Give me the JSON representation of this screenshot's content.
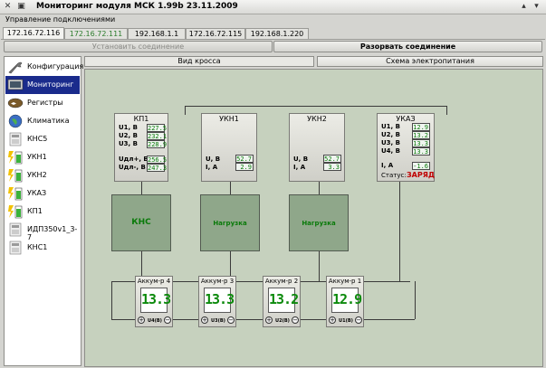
{
  "window": {
    "title": "Мониторинг модуля МСК 1.99b 23.11.2009"
  },
  "menu": {
    "label": "Управление подключениями"
  },
  "ip_tabs": [
    "172.16.72.116",
    "172.16.72.111",
    "192.168.1.1",
    "172.16.72.115",
    "192.168.1.220"
  ],
  "connection": {
    "connect_label": "Установить соединение",
    "disconnect_label": "Разорвать соединение"
  },
  "sidebar": {
    "items": [
      {
        "label": "Конфигурация",
        "icon": "wrench-icon"
      },
      {
        "label": "Мониторинг",
        "icon": "monitor-icon"
      },
      {
        "label": "Регистры",
        "icon": "register-icon"
      },
      {
        "label": "Климатика",
        "icon": "globe-icon"
      },
      {
        "label": "КНС5",
        "icon": "device-icon"
      },
      {
        "label": "УКН1",
        "icon": "battery-icon"
      },
      {
        "label": "УКН2",
        "icon": "battery-icon"
      },
      {
        "label": "УКАЗ",
        "icon": "battery-icon"
      },
      {
        "label": "КП1",
        "icon": "battery-icon"
      },
      {
        "label": "ИДП350v1_3-7",
        "icon": "device-icon"
      },
      {
        "label": "КНС1",
        "icon": "device-icon"
      }
    ]
  },
  "view_tabs": {
    "cross": "Вид кросса",
    "power": "Схема электропитания"
  },
  "devices": {
    "kp1": {
      "title": "КП1",
      "u1_label": "U1, В",
      "u1": "227.5",
      "u2_label": "U2, В",
      "u2": "232.1",
      "u3_label": "U3, В",
      "u3": "228.9",
      "udp_label": "Uдл+, В",
      "udp": "256.5",
      "udm_label": "Uдл-, В",
      "udm": "247.3"
    },
    "ukn1": {
      "title": "УКН1",
      "u_label": "U, В",
      "u": "52.7",
      "i_label": "I, А",
      "i": "2.9"
    },
    "ukn2": {
      "title": "УКН2",
      "u_label": "U, В",
      "u": "52.7",
      "i_label": "I, А",
      "i": "3.3"
    },
    "ukaz": {
      "title": "УКАЗ",
      "u1_label": "U1, В",
      "u1": "12.9",
      "u2_label": "U2, В",
      "u2": "13.2",
      "u3_label": "U3, В",
      "u3": "13.3",
      "u4_label": "U4, В",
      "u4": "13.3",
      "i_label": "I, А",
      "i": "-1.6",
      "status_label": "Статус:",
      "status": "ЗАРЯД"
    }
  },
  "boxes": {
    "kns": "КНС",
    "load1": "Нагрузка",
    "load2": "Нагрузка"
  },
  "batteries": [
    {
      "title": "Аккум-р 4",
      "value": "13.3",
      "label": "U4(В)"
    },
    {
      "title": "Аккум-р 3",
      "value": "13.3",
      "label": "U3(В)"
    },
    {
      "title": "Аккум-р 2",
      "value": "13.2",
      "label": "U2(В)"
    },
    {
      "title": "Аккум-р 1",
      "value": "12.9",
      "label": "U1(В)"
    }
  ],
  "colors": {
    "selected": "#1a2b8c",
    "value_text": "#0b7a0b",
    "status_text": "#c00000",
    "panel_bg": "#c6d1be",
    "box_bg": "#8fa78a"
  }
}
